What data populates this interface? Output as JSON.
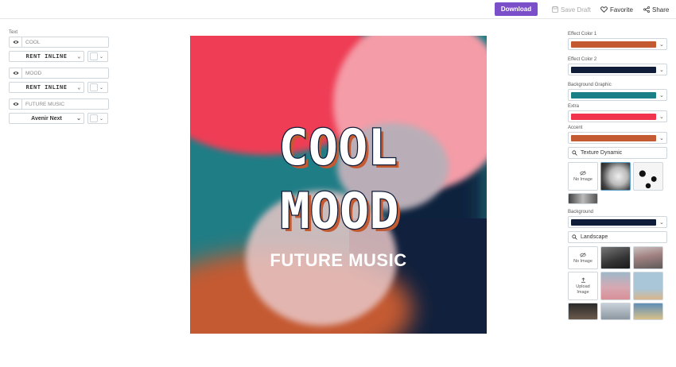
{
  "topbar": {
    "download_label": "Download",
    "save_draft_label": "Save Draft",
    "favorite_label": "Favorite",
    "share_label": "Share",
    "accent_color": "#7a4fc9"
  },
  "left_panel": {
    "section_label": "Text",
    "text_layers": [
      {
        "value": "COOL",
        "font": "RENT INLINE"
      },
      {
        "value": "MOOD",
        "font": "RENT INLINE"
      },
      {
        "value": "FUTURE MUSIC",
        "font": "Avenir Next"
      }
    ]
  },
  "canvas": {
    "line1": "COOL",
    "line2": "MOOD",
    "line3": "FUTURE MUSIC"
  },
  "right_panel": {
    "effect_color_1": {
      "label": "Effect Color 1",
      "color": "#c45a32"
    },
    "effect_color_2": {
      "label": "Effect Color 2",
      "color": "#0f1d3a"
    },
    "background_graphic": {
      "label": "Background Graphic",
      "color": "#1a7f86"
    },
    "extra": {
      "label": "Extra",
      "color": "#f0344e"
    },
    "accent": {
      "label": "Accent",
      "color": "#c45a32"
    },
    "texture_search": "Texture Dynamic",
    "no_image_label": "No Image",
    "background": {
      "label": "Background",
      "color": "#0f1d3a"
    },
    "landscape_search": "Landscape",
    "upload_image_label": "Upload Image"
  },
  "icons": {
    "save": "save-icon",
    "favorite": "heart-icon",
    "share": "share-icon",
    "eye": "eye-icon",
    "search": "search-icon",
    "chevron": "chevron-down-icon",
    "no_image": "eye-off-icon",
    "upload": "upload-icon"
  }
}
